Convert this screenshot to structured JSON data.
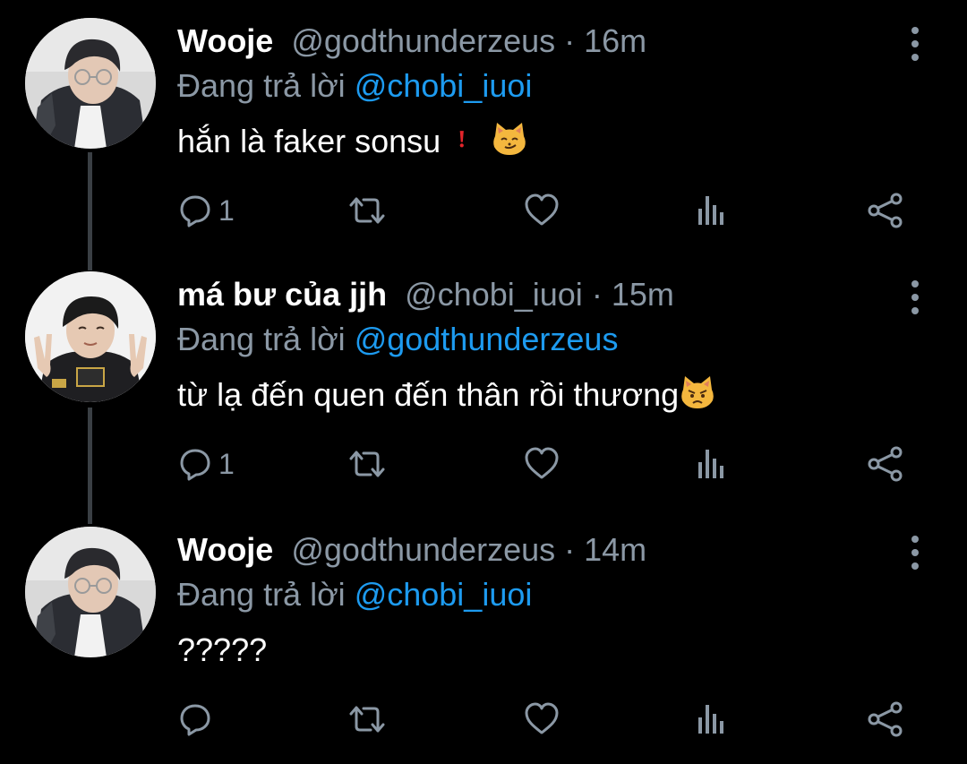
{
  "tweets": [
    {
      "name": "Wooje",
      "handle": "@godthunderzeus",
      "sep": " · ",
      "time": "16m",
      "replying_prefix": "Đang trả lời ",
      "replying_to": "@chobi_iuoi",
      "text": "hắn là faker sonsu",
      "emojis": [
        "exclamation-emoji",
        "smirk-cat-emoji"
      ],
      "reply_count": "1",
      "avatar": "wooje-avatar"
    },
    {
      "name": "má bư của jjh",
      "handle": "@chobi_iuoi",
      "sep": " · ",
      "time": "15m",
      "replying_prefix": "Đang trả lời ",
      "replying_to": "@godthunderzeus",
      "text": "từ lạ đến quen đến thân rồi thương",
      "emojis": [
        "pouting-cat-emoji"
      ],
      "reply_count": "1",
      "avatar": "peace-sign-avatar"
    },
    {
      "name": "Wooje",
      "handle": "@godthunderzeus",
      "sep": " · ",
      "time": "14m",
      "replying_prefix": "Đang trả lời ",
      "replying_to": "@chobi_iuoi",
      "text": "?????",
      "emojis": [],
      "reply_count": "",
      "avatar": "wooje-avatar"
    }
  ],
  "icons": {
    "reply": "comment-icon",
    "retweet": "retweet-icon",
    "like": "heart-icon",
    "views": "analytics-icon",
    "share": "share-icon",
    "more": "more-vertical-icon"
  },
  "colors": {
    "background": "#000000",
    "primary_text": "#ffffff",
    "secondary_text": "#8b98a5",
    "mention": "#1d9bf0",
    "thread_line": "#3a3f44"
  }
}
